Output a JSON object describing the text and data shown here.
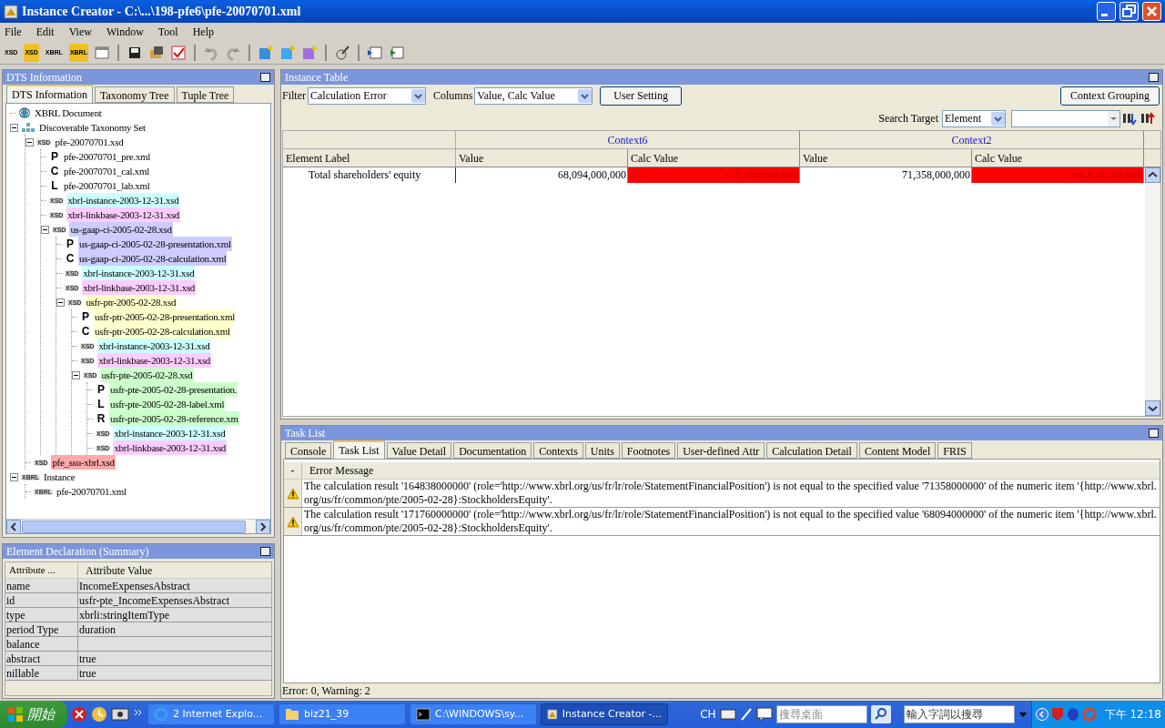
{
  "window": {
    "title": "Instance Creator - C:\\...\\198-pfe6\\pfe-20070701.xml"
  },
  "menu": [
    "File",
    "Edit",
    "View",
    "Window",
    "Tool",
    "Help"
  ],
  "toolbar": [
    {
      "kind": "doc",
      "text": "XSD"
    },
    {
      "kind": "docy",
      "text": "XSD"
    },
    {
      "kind": "doc",
      "text": "XBRL"
    },
    {
      "kind": "docy",
      "text": "XBRL"
    },
    {
      "kind": "win"
    },
    {
      "kind": "sep"
    },
    {
      "kind": "save"
    },
    {
      "kind": "open"
    },
    {
      "kind": "check"
    },
    {
      "kind": "sep"
    },
    {
      "kind": "undo",
      "disabled": true
    },
    {
      "kind": "redo",
      "disabled": true
    },
    {
      "kind": "sep"
    },
    {
      "kind": "addb"
    },
    {
      "kind": "addc"
    },
    {
      "kind": "addp"
    },
    {
      "kind": "sep"
    },
    {
      "kind": "tool"
    },
    {
      "kind": "sep"
    },
    {
      "kind": "winl"
    },
    {
      "kind": "winr"
    }
  ],
  "dts_panel": {
    "title": "DTS Information",
    "tabs": [
      {
        "label": "DTS Information",
        "selected": true
      },
      {
        "label": "Taxonomy Tree",
        "selected": false
      },
      {
        "label": "Tuple Tree",
        "selected": false
      }
    ],
    "tree": [
      {
        "label": "XBRL Document",
        "kind": "doc"
      },
      {
        "label": "Discoverable Taxonomy Set",
        "kind": "dts",
        "expanded": true,
        "children": [
          {
            "label": "pfe-20070701.xsd",
            "kind": "file",
            "badge": "XSD",
            "expanded": true,
            "children": [
              {
                "label": "pfe-20070701_pre.xml",
                "kind": "file",
                "badge": "P"
              },
              {
                "label": "pfe-20070701_cal.xml",
                "kind": "file",
                "badge": "C"
              },
              {
                "label": "pfe-20070701_lab.xml",
                "kind": "file",
                "badge": "L"
              },
              {
                "label": "xbrl-instance-2003-12-31.xsd",
                "kind": "file",
                "badge": "XSD",
                "color": "#ccffff"
              },
              {
                "label": "xbrl-linkbase-2003-12-31.xsd",
                "kind": "file",
                "badge": "XSD",
                "color": "#ffccff"
              },
              {
                "label": "us-gaap-ci-2005-02-28.xsd",
                "kind": "file",
                "badge": "XSD",
                "color": "#ccccff",
                "expanded": true,
                "children": [
                  {
                    "label": "us-gaap-ci-2005-02-28-presentation.xml",
                    "kind": "file",
                    "badge": "P",
                    "color": "#ccccff"
                  },
                  {
                    "label": "us-gaap-ci-2005-02-28-calculation.xml",
                    "kind": "file",
                    "badge": "C",
                    "color": "#ccccff"
                  },
                  {
                    "label": "xbrl-instance-2003-12-31.xsd",
                    "kind": "file",
                    "badge": "XSD",
                    "color": "#ccffff"
                  },
                  {
                    "label": "xbrl-linkbase-2003-12-31.xsd",
                    "kind": "file",
                    "badge": "XSD",
                    "color": "#ffccff"
                  },
                  {
                    "label": "usfr-ptr-2005-02-28.xsd",
                    "kind": "file",
                    "badge": "XSD",
                    "color": "#ffffcc",
                    "expanded": true,
                    "children": [
                      {
                        "label": "usfr-ptr-2005-02-28-presentation.xml",
                        "kind": "file",
                        "badge": "P",
                        "color": "#ffffcc"
                      },
                      {
                        "label": "usfr-ptr-2005-02-28-calculation.xml",
                        "kind": "file",
                        "badge": "C",
                        "color": "#ffffcc"
                      },
                      {
                        "label": "xbrl-instance-2003-12-31.xsd",
                        "kind": "file",
                        "badge": "XSD",
                        "color": "#ccffff"
                      },
                      {
                        "label": "xbrl-linkbase-2003-12-31.xsd",
                        "kind": "file",
                        "badge": "XSD",
                        "color": "#ffccff"
                      },
                      {
                        "label": "usfr-pte-2005-02-28.xsd",
                        "kind": "file",
                        "badge": "XSD",
                        "color": "#ccffcc",
                        "expanded": true,
                        "children": [
                          {
                            "label": "usfr-pte-2005-02-28-presentation.",
                            "kind": "file",
                            "badge": "P",
                            "color": "#ccffcc"
                          },
                          {
                            "label": "usfr-pte-2005-02-28-label.xml",
                            "kind": "file",
                            "badge": "L",
                            "color": "#ccffcc"
                          },
                          {
                            "label": "usfr-pte-2005-02-28-reference.xm",
                            "kind": "file",
                            "badge": "R",
                            "color": "#ccffcc"
                          },
                          {
                            "label": "xbrl-instance-2003-12-31.xsd",
                            "kind": "file",
                            "badge": "XSD",
                            "color": "#ccffff"
                          },
                          {
                            "label": "xbrl-linkbase-2003-12-31.xsd",
                            "kind": "file",
                            "badge": "XSD",
                            "color": "#ffccff"
                          }
                        ]
                      }
                    ]
                  }
                ]
              }
            ]
          },
          {
            "label": "pfe_ssu-xbrl.xsd",
            "kind": "file",
            "badge": "XSD",
            "color": "#ffaaaa"
          }
        ]
      },
      {
        "label": "Instance",
        "kind": "file",
        "badge": "XBRL",
        "expanded": true,
        "children": [
          {
            "label": "pfe-20070701.xml",
            "kind": "file",
            "badge": "XBRL"
          }
        ]
      }
    ]
  },
  "element_panel": {
    "title": "Element Declaration (Summary)",
    "columns": [
      "Attribute ...",
      "Attribute Value"
    ],
    "rows": [
      {
        "name": "name",
        "value": "IncomeExpensesAbstract"
      },
      {
        "name": "id",
        "value": "usfr-pte_IncomeExpensesAbstract"
      },
      {
        "name": "type",
        "value": "xbrli:stringItemType"
      },
      {
        "name": "period Type",
        "value": "duration"
      },
      {
        "name": "balance"
      },
      {
        "name": "abstract",
        "value": "true"
      },
      {
        "name": "nillable",
        "value": "true"
      }
    ]
  },
  "instance_panel": {
    "title": "Instance Table",
    "filter_label": "Filter",
    "filter": "Calculation Error",
    "columns_label": "Columns",
    "columns_value": "Value, Calc Value",
    "user_setting": "User Setting",
    "context_grouping": "Context Grouping",
    "search_label": "Search Target",
    "search_target": "Element",
    "label_column": "Element Label",
    "contexts": [
      {
        "name": "Context6",
        "columns": [
          "Value",
          "Calc Value"
        ]
      },
      {
        "name": "Context2",
        "columns": [
          "Value",
          "Calc Value"
        ]
      }
    ],
    "rows": [
      {
        "label": "Total shareholders' equity",
        "cells": [
          {
            "text": "68,094,000,000",
            "error": false
          },
          {
            "text": "171,760,000,000",
            "error": true
          },
          {
            "text": "71,358,000,000",
            "error": false
          },
          {
            "text": "164,838,000,000",
            "error": true
          }
        ]
      }
    ]
  },
  "task_panel": {
    "title": "Task List",
    "tabs": [
      {
        "label": "Console",
        "selected": false
      },
      {
        "label": "Task List",
        "selected": true
      },
      {
        "label": "Value Detail",
        "selected": false
      },
      {
        "label": "Documentation",
        "selected": false
      },
      {
        "label": "Contexts",
        "selected": false
      },
      {
        "label": "Units",
        "selected": false
      },
      {
        "label": "Footnotes",
        "selected": false
      },
      {
        "label": "User-defined Attr",
        "selected": false
      },
      {
        "label": "Calculation Detail",
        "selected": false
      },
      {
        "label": "Content Model",
        "selected": false
      },
      {
        "label": "FRIS",
        "selected": false
      }
    ],
    "columns": [
      "-",
      "Error Message"
    ],
    "rows": [
      {
        "kind": "warning",
        "message": "The calculation result '164838000000' (role='http://www.xbrl.org/us/fr/lr/role/StatementFinancialPosition') is not equal to the specified value '71358000000' of the numeric item '{http://www.xbrl.org/us/fr/common/pte/2005-02-28}:StockholdersEquity'."
      },
      {
        "kind": "warning",
        "message": "The calculation result '171760000000' (role='http://www.xbrl.org/us/fr/lr/role/StatementFinancialPosition') is not equal to the specified value '68094000000' of the numeric item '{http://www.xbrl.org/us/fr/common/pte/2005-02-28}:StockholdersEquity'."
      }
    ],
    "status": "Error: 0, Warning: 2"
  },
  "taskbar": {
    "start": "開始",
    "tasks": [
      {
        "label": "2 Internet Explo...",
        "kind": "browser",
        "selected": false
      },
      {
        "label": "biz21_39",
        "kind": "folder",
        "selected": false
      },
      {
        "label": "C:\\WINDOWS\\sy...",
        "kind": "terminal",
        "selected": false
      },
      {
        "label": "Instance Creator -...",
        "kind": "app",
        "selected": true
      }
    ],
    "lang": "CH",
    "desktop_search": "搜尋桌面",
    "web_search": "輸入字詞以搜尋",
    "clock": "下午 12:18"
  }
}
